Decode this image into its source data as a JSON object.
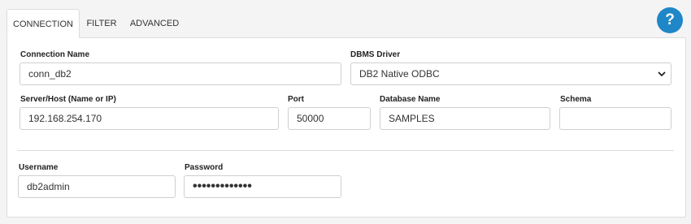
{
  "tabs": [
    {
      "label": "CONNECTION",
      "active": true
    },
    {
      "label": "FILTER",
      "active": false
    },
    {
      "label": "ADVANCED",
      "active": false
    }
  ],
  "help": {
    "label": "?",
    "icon": "help-icon",
    "color": "#1f87c7"
  },
  "form": {
    "connection_name": {
      "label": "Connection Name",
      "value": "conn_db2"
    },
    "dbms_driver": {
      "label": "DBMS Driver",
      "value": "DB2 Native ODBC"
    },
    "server_host": {
      "label": "Server/Host (Name or IP)",
      "value": "192.168.254.170"
    },
    "port": {
      "label": "Port",
      "value": "50000"
    },
    "database_name": {
      "label": "Database Name",
      "value": "SAMPLES"
    },
    "schema": {
      "label": "Schema",
      "value": ""
    },
    "username": {
      "label": "Username",
      "value": "db2admin"
    },
    "password": {
      "label": "Password",
      "value": "•••••••••••••"
    }
  }
}
